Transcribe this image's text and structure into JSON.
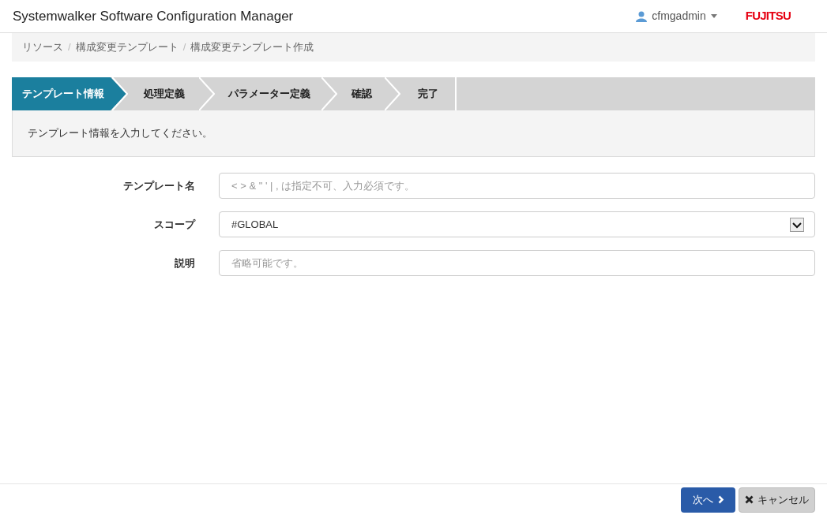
{
  "header": {
    "title": "Systemwalker Software Configuration Manager",
    "user": "cfmgadmin",
    "logo": "FUJITSU"
  },
  "breadcrumb": [
    "リソース",
    "構成変更テンプレート",
    "構成変更テンプレート作成"
  ],
  "breadcrumb_separator": "/",
  "steps": [
    {
      "label": "テンプレート情報",
      "selected": true
    },
    {
      "label": "処理定義",
      "selected": false
    },
    {
      "label": "パラメーター定義",
      "selected": false
    },
    {
      "label": "確認",
      "selected": false
    },
    {
      "label": "完了",
      "selected": false
    }
  ],
  "message": "テンプレート情報を入力してください。",
  "form": [
    {
      "kind": "text",
      "label": "テンプレート名",
      "placeholder": "< > & \" ' | , は指定不可、入力必須です。"
    },
    {
      "kind": "select",
      "label": "スコープ",
      "value": "#GLOBAL"
    },
    {
      "kind": "text",
      "label": "説明",
      "placeholder": "省略可能です。"
    }
  ],
  "buttons": {
    "next": "次へ",
    "cancel": "キャンセル"
  }
}
